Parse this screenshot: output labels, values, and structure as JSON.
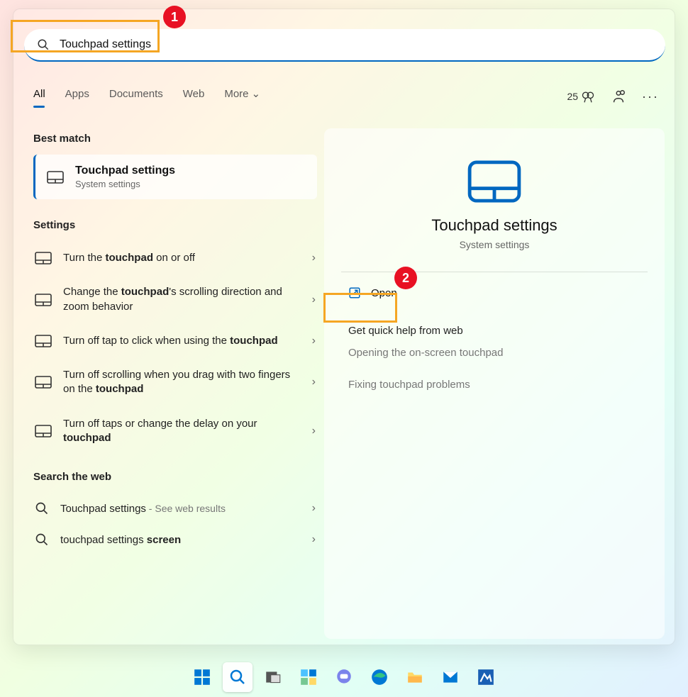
{
  "annotations": {
    "badge1": "1",
    "badge2": "2"
  },
  "search": {
    "query": "Touchpad settings"
  },
  "tabs": [
    "All",
    "Apps",
    "Documents",
    "Web",
    "More"
  ],
  "rewards": {
    "points": "25"
  },
  "sections": {
    "best_match_h": "Best match",
    "settings_h": "Settings",
    "web_h": "Search the web"
  },
  "best_match": {
    "title": "Touchpad settings",
    "subtitle": "System settings"
  },
  "settings": [
    {
      "pre": "Turn the ",
      "bold": "touchpad",
      "post": " on or off"
    },
    {
      "pre": "Change the ",
      "bold": "touchpad",
      "post": "'s scrolling direction and zoom behavior"
    },
    {
      "pre": "Turn off tap to click when using the ",
      "bold": "touchpad",
      "post": ""
    },
    {
      "pre": "Turn off scrolling when you drag with two fingers on the ",
      "bold": "touchpad",
      "post": ""
    },
    {
      "pre": "Turn off taps or change the delay on your ",
      "bold": "touchpad",
      "post": ""
    }
  ],
  "web_results": [
    {
      "text": "Touchpad settings",
      "suffix": " - See web results"
    },
    {
      "pre": "touchpad settings ",
      "bold": "screen"
    }
  ],
  "right_panel": {
    "title": "Touchpad settings",
    "subtitle": "System settings",
    "open": "Open",
    "help_h": "Get quick help from web",
    "help_links": [
      "Opening the on-screen touchpad",
      "Fixing touchpad problems"
    ]
  },
  "colors": {
    "accent": "#0067c0",
    "annot": "#f5a623",
    "badge": "#e81123"
  }
}
